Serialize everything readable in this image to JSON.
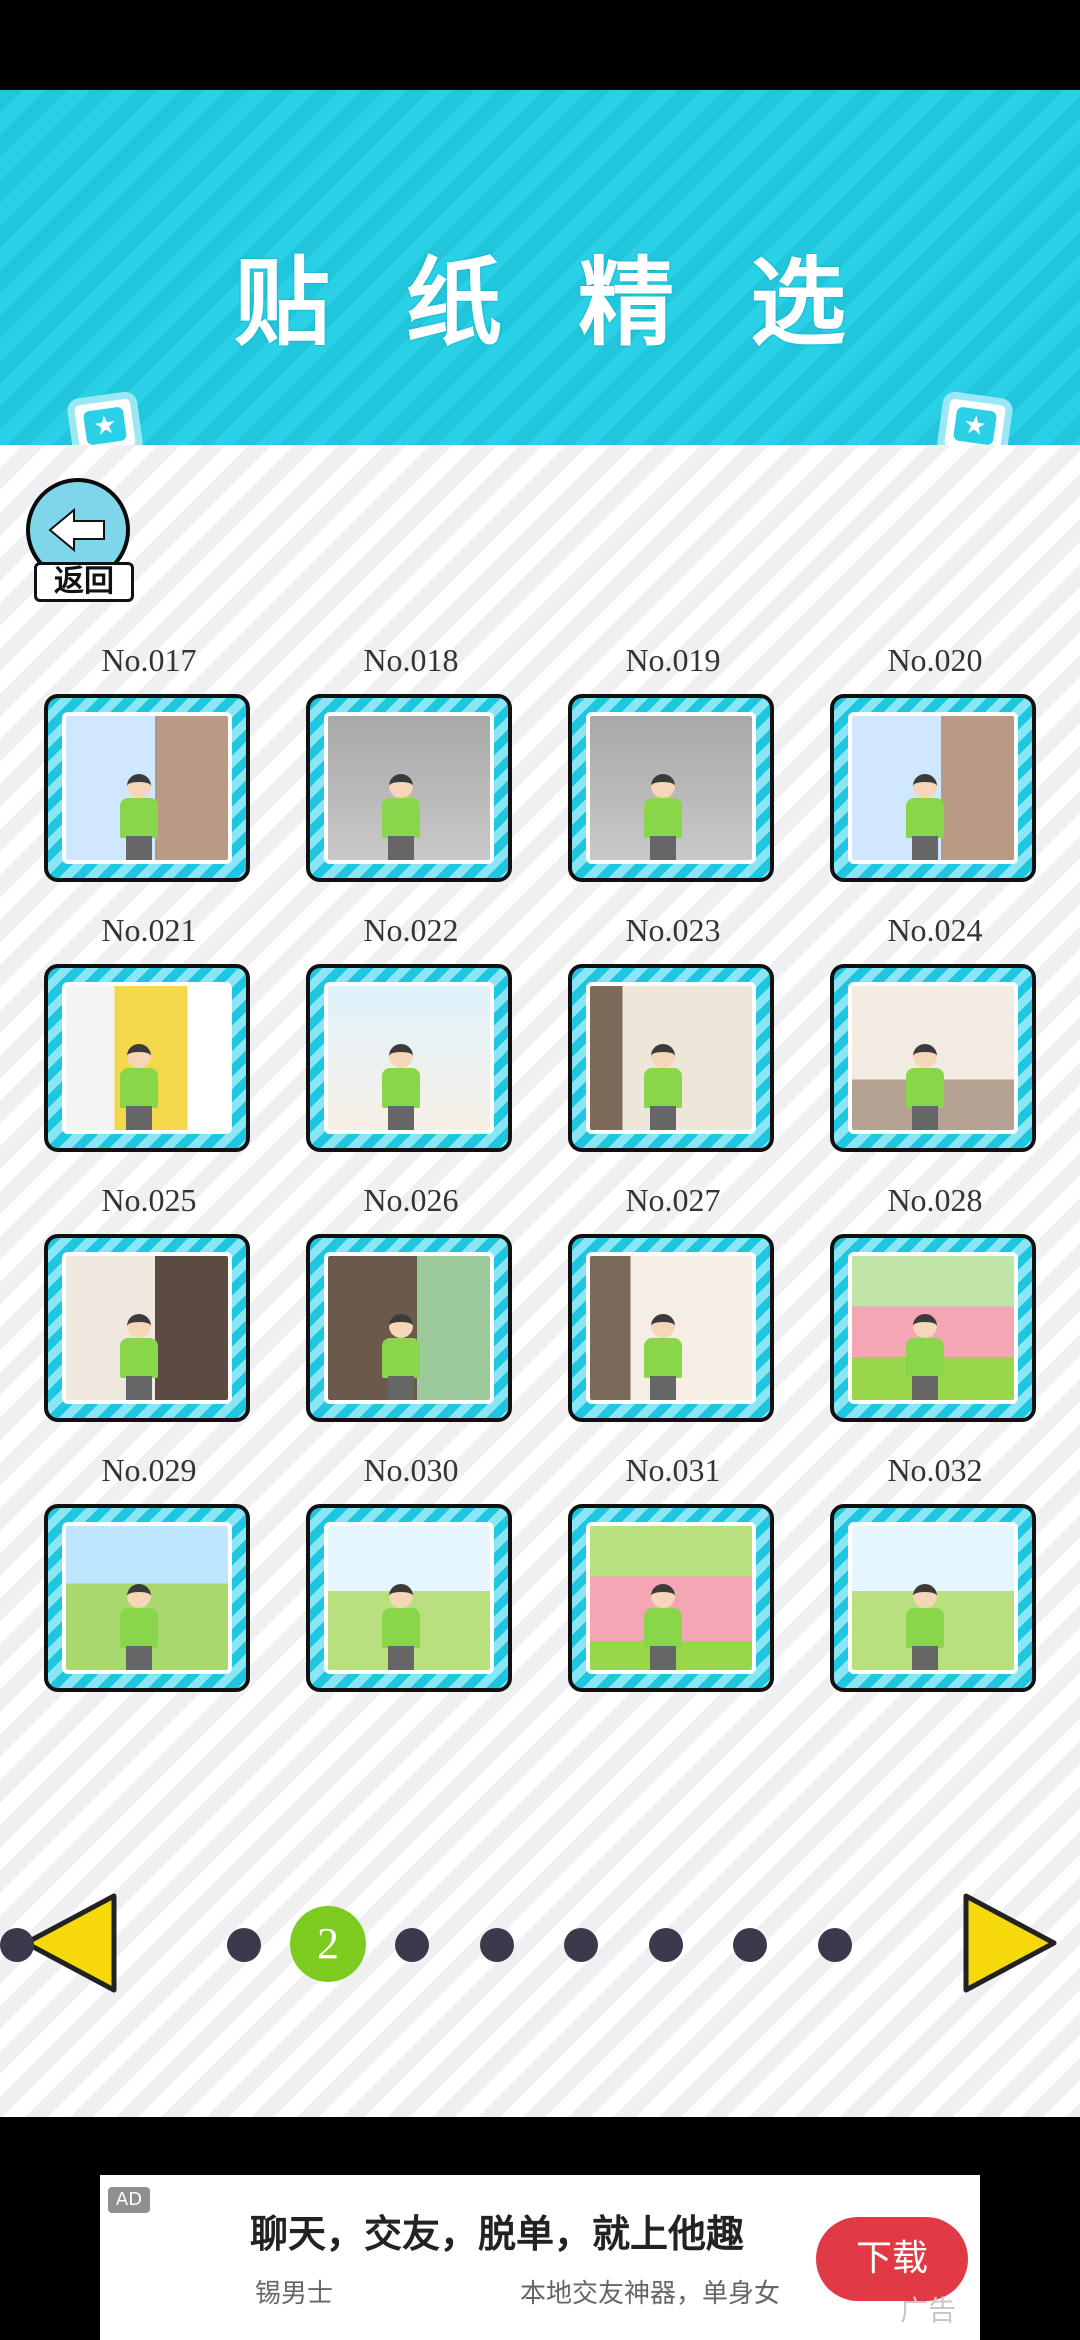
{
  "header": {
    "title": "贴纸精选"
  },
  "back": {
    "label": "返回"
  },
  "stickers": [
    {
      "label": "No.017",
      "scene": "window-break"
    },
    {
      "label": "No.018",
      "scene": "ghost-note"
    },
    {
      "label": "No.019",
      "scene": "ghost-note"
    },
    {
      "label": "No.020",
      "scene": "window-break"
    },
    {
      "label": "No.021",
      "scene": "doorway"
    },
    {
      "label": "No.022",
      "scene": "mother"
    },
    {
      "label": "No.023",
      "scene": "phone-wall"
    },
    {
      "label": "No.024",
      "scene": "phone-floor"
    },
    {
      "label": "No.025",
      "scene": "reading"
    },
    {
      "label": "No.026",
      "scene": "locker"
    },
    {
      "label": "No.027",
      "scene": "music"
    },
    {
      "label": "No.028",
      "scene": "stage"
    },
    {
      "label": "No.029",
      "scene": "wedding-waiter"
    },
    {
      "label": "No.030",
      "scene": "wedding-couple"
    },
    {
      "label": "No.031",
      "scene": "stage-fall"
    },
    {
      "label": "No.032",
      "scene": "wedding-couple"
    }
  ],
  "pagination": {
    "current": "2",
    "total_pages": 9,
    "current_index": 1
  },
  "ad": {
    "tag": "AD",
    "headline": "聊天，交友，脱单，就上他趣",
    "sub_left": "锡男士",
    "sub_mid": "本地交友神器，单身女",
    "download": "下载",
    "corner": "广告"
  },
  "colors": {
    "header": "#2ad0e6",
    "frame": "#1fc6e0",
    "active_page": "#7dcb1e",
    "arrow": "#f5d90a"
  }
}
